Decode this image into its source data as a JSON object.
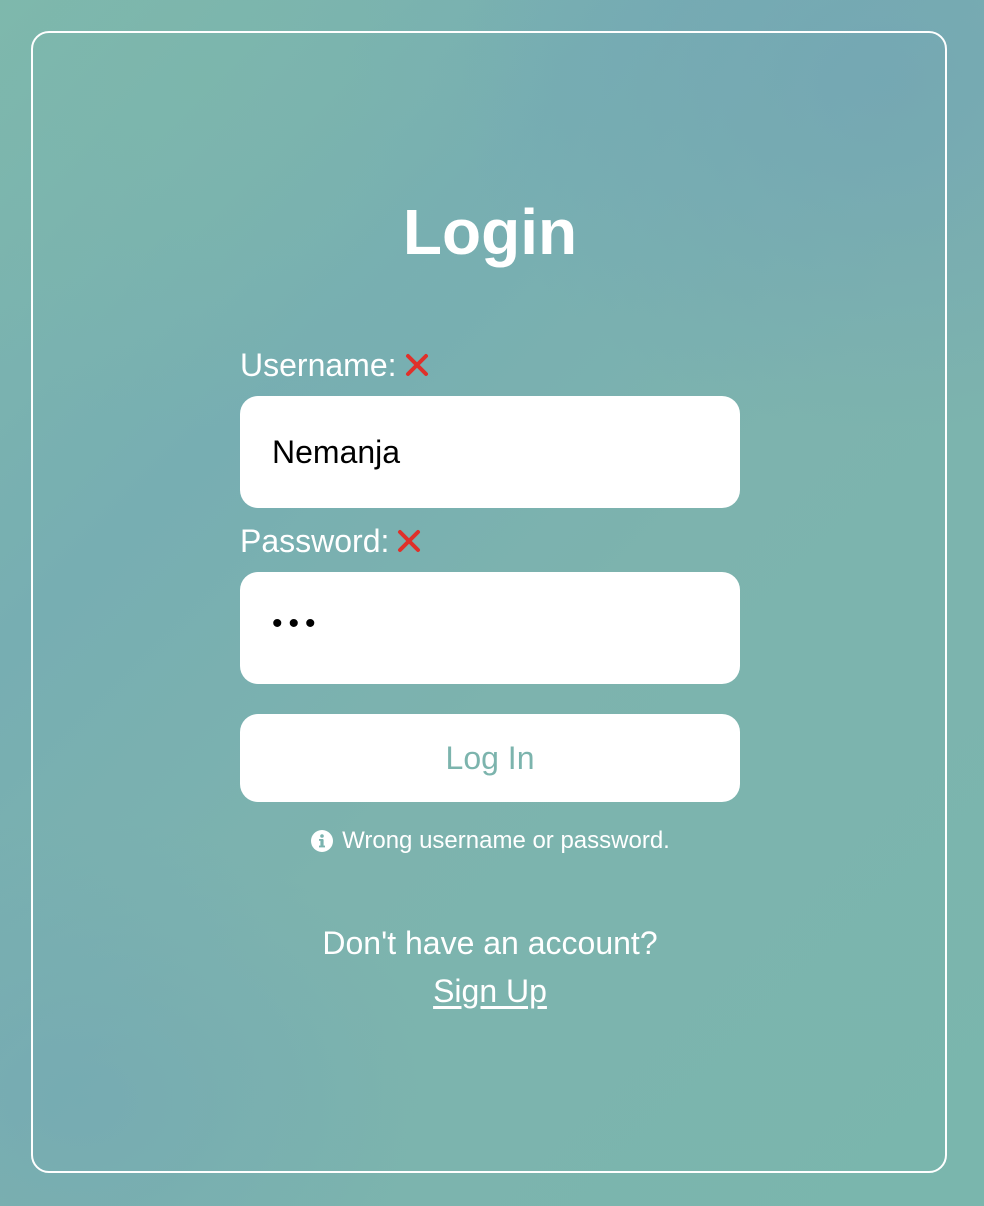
{
  "login": {
    "title": "Login",
    "username_label": "Username:",
    "username_value": "Nemanja",
    "password_label": "Password:",
    "password_mask": "•••",
    "submit_label": "Log In",
    "error_message": "Wrong username or password.",
    "no_account_text": "Don't have an account?",
    "signup_link": "Sign Up"
  },
  "icons": {
    "invalid": "x-mark-icon",
    "info": "info-circle-icon"
  },
  "colors": {
    "background": "#7ab3af",
    "invalid_mark": "#e0302a",
    "button_text": "#7cb4ad",
    "card_border": "#ffffff"
  }
}
